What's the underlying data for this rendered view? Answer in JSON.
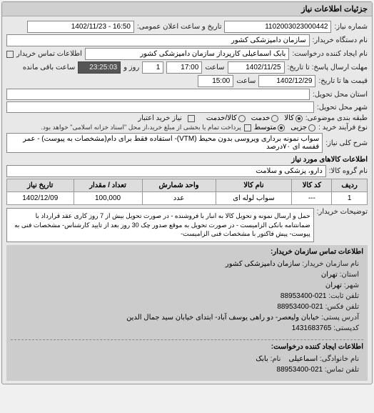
{
  "header": {
    "title": "جزئیات اطلاعات نیاز"
  },
  "fields": {
    "req_number_lbl": "شماره نیاز:",
    "req_number": "1102003023000442",
    "announce_datetime_lbl": "تاریخ و ساعت اعلان عمومی:",
    "announce_datetime": "16:50 - 1402/11/23",
    "buyer_org_lbl": "نام دستگاه خریدار:",
    "buyer_org": "سازمان دامپزشکی کشور",
    "requester_lbl": "نام ایجاد کننده درخواست:",
    "requester": "بابک اسماعیلی کارپرداز سازمان دامپزشکی کشور",
    "buyer_contact_lbl": "اطلاعات تماس خریدار",
    "deadline_lbl": "مهلت ارسال پاسخ: تا تاریخ:",
    "deadline_date": "1402/11/25",
    "deadline_time_lbl": "ساعت",
    "deadline_time": "17:00",
    "remaining_days": "1",
    "remaining_days_lbl": "روز و",
    "remaining_time": "23:25:03",
    "remaining_time_lbl": "ساعت باقی مانده",
    "price_until_lbl": "قیمت ها تا تاریخ:",
    "price_until_date": "1402/12/29",
    "price_until_time_lbl": "ساعت",
    "price_until_time": "15:00",
    "delivery_state_lbl": "استان محل تحویل:",
    "delivery_city_lbl": "شهر محل تحویل:",
    "category_lbl": "طبقه بندی موضوعی:",
    "cat_goods": "کالا",
    "cat_service": "خدمت",
    "cat_credit": "کالا/خدمت",
    "buy_process_lbl": "نوع فرآیند خرید :",
    "proc_high": "جزیی",
    "proc_mid": "متوسط",
    "proc_note": "پرداخت تمام یا بخشی از مبلغ خرید،از محل \"اسناد خزانه اسلامی\" خواهد بود.",
    "need_desc_lbl": "شرح کلی نیاز:",
    "need_desc": "سواب نمونه برداری ویروسی بدون محیط (VTM)- استفاده فقط برای دام(مشخصات به پیوست) - عمر قفسه ای ۷۰درصد"
  },
  "goods": {
    "header": "اطلاعات کالاهای مورد نیاز",
    "group_lbl": "نام گروه کالا:",
    "group": "دارو، پزشکی و سلامت",
    "cols": {
      "row": "ردیف",
      "code": "کد کالا",
      "name": "نام کالا",
      "unit": "واحد شمارش",
      "qty": "تعداد / مقدار",
      "date": "تاریخ نیاز"
    },
    "rows": [
      {
        "row": "1",
        "code": "---",
        "name": "سواب لوله ای",
        "unit": "عدد",
        "qty": "100,000",
        "date": "1402/12/09"
      }
    ]
  },
  "buyer_note": {
    "lbl": "توضیحات خریدار:",
    "text": "حمل و ارسال نمونه و تحویل کالا به انبار با فروشنده - در صورت تحویل بیش از 7 روز کاری عقد قرارداد با ضمانتنامه بانکی الزامیست - در صورت تحویل به موقع صدور چک 30 روز بعد از تایید کارشناس- مشخصات فنی به پیوست- پیش فاکتور با مشخصات فنی الزامیست-"
  },
  "contact_buyer": {
    "header": "اطلاعات تماس سازمان خریدار:",
    "org_lbl": "نام سازمان خریدار:",
    "org": "سازمان دامپزشکی کشور",
    "state_lbl": "استان:",
    "state": "تهران",
    "city_lbl": "شهر:",
    "city": "تهران",
    "phone_lbl": "تلفن ثابت:",
    "phone": "021-88953400",
    "fax_lbl": "تلفن فکس:",
    "fax": "021-88953400",
    "addr_lbl": "آدرس پستی:",
    "addr": "خیابان ولیعصر- دو راهی یوسف آباد- ابتدای خیابان سید جمال الدین",
    "zip_lbl": "کدپستی:",
    "zip": "1431683765"
  },
  "contact_requester": {
    "header": "اطلاعات ایجاد کننده درخواست:",
    "family_lbl": "نام خانوادگی:",
    "family": "اسماعیلی",
    "name_lbl": "نام:",
    "name": "بابک",
    "phone_lbl": "تلفن تماس:",
    "phone": "021-88953400"
  }
}
